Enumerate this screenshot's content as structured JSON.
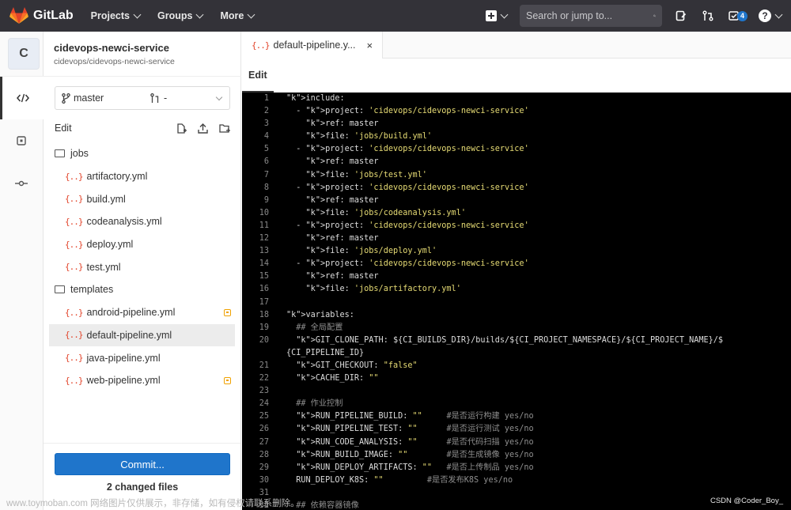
{
  "nav": {
    "brand": "GitLab",
    "items": [
      {
        "label": "Projects"
      },
      {
        "label": "Groups"
      },
      {
        "label": "More"
      }
    ],
    "search_placeholder": "Search or jump to...",
    "todo_count": "4"
  },
  "project": {
    "avatar_letter": "C",
    "name": "cidevops-newci-service",
    "path": "cidevops/cidevops-newci-service"
  },
  "ide": {
    "branch": "master",
    "merge_request": "-",
    "edit_label": "Edit",
    "tree": [
      {
        "type": "folder",
        "name": "jobs"
      },
      {
        "type": "file",
        "name": "artifactory.yml"
      },
      {
        "type": "file",
        "name": "build.yml"
      },
      {
        "type": "file",
        "name": "codeanalysis.yml"
      },
      {
        "type": "file",
        "name": "deploy.yml"
      },
      {
        "type": "file",
        "name": "test.yml"
      },
      {
        "type": "folder",
        "name": "templates"
      },
      {
        "type": "file",
        "name": "android-pipeline.yml",
        "modified": true
      },
      {
        "type": "file",
        "name": "default-pipeline.yml",
        "selected": true
      },
      {
        "type": "file",
        "name": "java-pipeline.yml"
      },
      {
        "type": "file",
        "name": "web-pipeline.yml",
        "modified": true
      }
    ],
    "commit_label": "Commit...",
    "changed_files": "2 changed files"
  },
  "editor": {
    "tab_label": "default-pipeline.y...",
    "close_glyph": "×",
    "mode_tab": "Edit",
    "lines": [
      {
        "n": "1",
        "t": "include:"
      },
      {
        "n": "2",
        "t": "  - project: 'cidevops/cidevops-newci-service'"
      },
      {
        "n": "3",
        "t": "    ref: master"
      },
      {
        "n": "4",
        "t": "    file: 'jobs/build.yml'"
      },
      {
        "n": "5",
        "t": "  - project: 'cidevops/cidevops-newci-service'"
      },
      {
        "n": "6",
        "t": "    ref: master"
      },
      {
        "n": "7",
        "t": "    file: 'jobs/test.yml'"
      },
      {
        "n": "8",
        "t": "  - project: 'cidevops/cidevops-newci-service'"
      },
      {
        "n": "9",
        "t": "    ref: master"
      },
      {
        "n": "10",
        "t": "    file: 'jobs/codeanalysis.yml'"
      },
      {
        "n": "11",
        "t": "  - project: 'cidevops/cidevops-newci-service'"
      },
      {
        "n": "12",
        "t": "    ref: master"
      },
      {
        "n": "13",
        "t": "    file: 'jobs/deploy.yml'"
      },
      {
        "n": "14",
        "t": "  - project: 'cidevops/cidevops-newci-service'"
      },
      {
        "n": "15",
        "t": "    ref: master"
      },
      {
        "n": "16",
        "t": "    file: 'jobs/artifactory.yml'"
      },
      {
        "n": "17",
        "t": ""
      },
      {
        "n": "18",
        "t": "variables:"
      },
      {
        "n": "19",
        "t": "  ## 全局配置"
      },
      {
        "n": "20",
        "t": "  GIT_CLONE_PATH: ${CI_BUILDS_DIR}/builds/${CI_PROJECT_NAMESPACE}/${CI_PROJECT_NAME}/$"
      },
      {
        "n": "",
        "t": "{CI_PIPELINE_ID}"
      },
      {
        "n": "21",
        "t": "  GIT_CHECKOUT: \"false\""
      },
      {
        "n": "22",
        "t": "  CACHE_DIR: \"\""
      },
      {
        "n": "23",
        "t": ""
      },
      {
        "n": "24",
        "t": "  ## 作业控制"
      },
      {
        "n": "25",
        "t": "  RUN_PIPELINE_BUILD: \"\"     #是否运行构建 yes/no"
      },
      {
        "n": "26",
        "t": "  RUN_PIPELINE_TEST: \"\"      #是否运行测试 yes/no"
      },
      {
        "n": "27",
        "t": "  RUN_CODE_ANALYSIS: \"\"      #是否代码扫描 yes/no"
      },
      {
        "n": "28",
        "t": "  RUN_BUILD_IMAGE: \"\"        #是否生成镜像 yes/no"
      },
      {
        "n": "29",
        "t": "  RUN_DEPLOY_ARTIFACTS: \"\"   #是否上传制品 yes/no"
      },
      {
        "n": "30",
        "t": "  RUN_DEPLOY_K8S: \"\"         #是否发布K8S yes/no"
      },
      {
        "n": "31",
        "t": ""
      },
      {
        "n": "32",
        "t": "  ## 依赖容器镜像"
      }
    ]
  },
  "watermark": {
    "left": "www.toymoban.com 网络图片仅供展示，非存储，如有侵权请联系删除。",
    "right": "CSDN @Coder_Boy_"
  },
  "colors": {
    "topbar": "#333238",
    "accent": "#1f75cb",
    "gitlab_orange": "#e24329",
    "modified": "#f0a200",
    "editor_bg": "#000000"
  }
}
